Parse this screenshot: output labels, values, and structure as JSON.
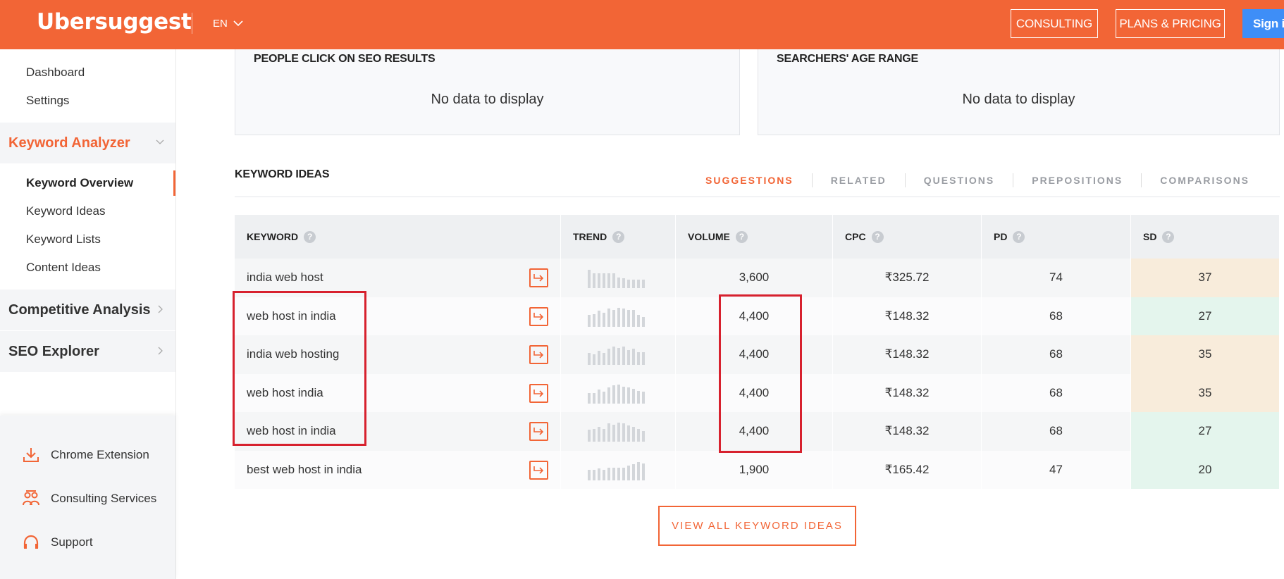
{
  "header": {
    "logo": "Ubersuggest",
    "language": "EN",
    "consulting_label": "CONSULTING",
    "plans_label": "PLANS & PRICING",
    "signin_label": "Sign in"
  },
  "sidebar": {
    "top_links": [
      "Dashboard",
      "Settings"
    ],
    "keyword_analyzer": {
      "label": "Keyword Analyzer",
      "items": [
        "Keyword Overview",
        "Keyword Ideas",
        "Keyword Lists",
        "Content Ideas"
      ]
    },
    "competitive_analysis": "Competitive Analysis",
    "seo_explorer": "SEO Explorer",
    "bottom_items": [
      {
        "label": "Chrome Extension",
        "icon": "download-icon"
      },
      {
        "label": "Consulting Services",
        "icon": "people-icon"
      },
      {
        "label": "Support",
        "icon": "headset-icon"
      }
    ]
  },
  "cards": {
    "left": {
      "title": "PEOPLE CLICK ON SEO RESULTS",
      "empty": "No data to display"
    },
    "right": {
      "title": "SEARCHERS' AGE RANGE",
      "empty": "No data to display"
    }
  },
  "keyword_ideas": {
    "title": "KEYWORD IDEAS",
    "tabs": [
      "SUGGESTIONS",
      "RELATED",
      "QUESTIONS",
      "PREPOSITIONS",
      "COMPARISONS"
    ],
    "active_tab": "SUGGESTIONS",
    "columns": [
      "KEYWORD",
      "TREND",
      "VOLUME",
      "CPC",
      "PD",
      "SD"
    ],
    "rows": [
      {
        "keyword": "india web host",
        "volume": "3,600",
        "cpc": "₹325.72",
        "pd": "74",
        "sd": "37",
        "sd_level": "tan",
        "trend": [
          0.85,
          0.7,
          0.7,
          0.7,
          0.7,
          0.7,
          0.5,
          0.45,
          0.4,
          0.4,
          0.4,
          0.4
        ]
      },
      {
        "keyword": "web host in india",
        "volume": "4,400",
        "cpc": "₹148.32",
        "pd": "68",
        "sd": "27",
        "sd_level": "green",
        "trend": [
          0.55,
          0.6,
          0.75,
          0.65,
          0.85,
          0.8,
          0.9,
          0.85,
          0.8,
          0.8,
          0.55,
          0.45
        ]
      },
      {
        "keyword": "india web hosting",
        "volume": "4,400",
        "cpc": "₹148.32",
        "pd": "68",
        "sd": "35",
        "sd_level": "tan",
        "trend": [
          0.55,
          0.5,
          0.65,
          0.55,
          0.75,
          0.85,
          0.8,
          0.85,
          0.7,
          0.75,
          0.6,
          0.6
        ]
      },
      {
        "keyword": "web host india",
        "volume": "4,400",
        "cpc": "₹148.32",
        "pd": "68",
        "sd": "35",
        "sd_level": "tan",
        "trend": [
          0.5,
          0.5,
          0.65,
          0.55,
          0.75,
          0.85,
          0.9,
          0.8,
          0.75,
          0.7,
          0.6,
          0.55
        ]
      },
      {
        "keyword": "web host in india",
        "volume": "4,400",
        "cpc": "₹148.32",
        "pd": "68",
        "sd": "27",
        "sd_level": "green",
        "trend": [
          0.55,
          0.6,
          0.7,
          0.6,
          0.85,
          0.8,
          0.9,
          0.85,
          0.75,
          0.7,
          0.6,
          0.5
        ]
      },
      {
        "keyword": "best web host in india",
        "volume": "1,900",
        "cpc": "₹165.42",
        "pd": "47",
        "sd": "20",
        "sd_level": "green",
        "trend": [
          0.5,
          0.5,
          0.55,
          0.5,
          0.6,
          0.6,
          0.6,
          0.6,
          0.7,
          0.75,
          0.85,
          0.8
        ]
      }
    ],
    "view_all_label": "VIEW ALL KEYWORD IDEAS"
  },
  "colors": {
    "brand": "#f26536",
    "signin": "#3e8ef7",
    "highlight": "#d7212e",
    "sd_tan": "#f8ecdb",
    "sd_green": "#e4f5ed"
  }
}
